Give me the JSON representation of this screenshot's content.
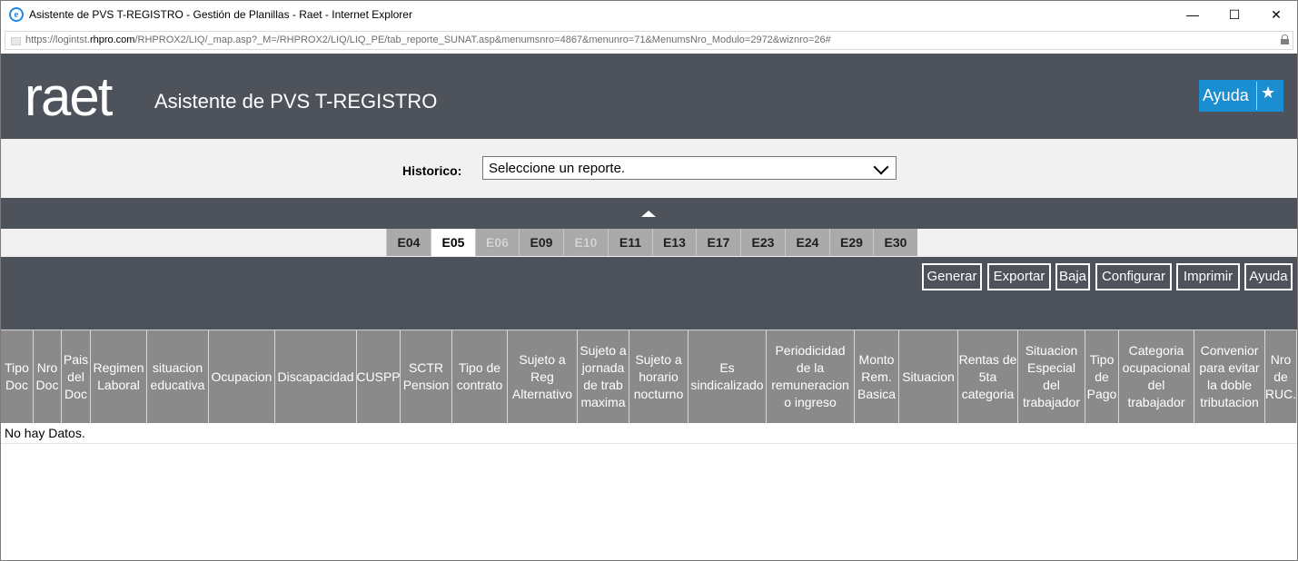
{
  "window": {
    "title": "Asistente de PVS T-REGISTRO - Gestión de Planillas - Raet - Internet Explorer",
    "controls": {
      "minimize": "—",
      "maximize": "☐",
      "close": "✕"
    },
    "icon": "ie-icon"
  },
  "address": {
    "url_prefix": "https://logintst.",
    "url_domain": "rhpro.com",
    "url_rest": "/RHPROX2/LIQ/_map.asp?_M=/RHPROX2/LIQ/LIQ_PE/tab_reporte_SUNAT.asp&menumsnro=4867&menunro=71&MenumsNro_Modulo=2972&wiznro=26#"
  },
  "header": {
    "logo": "raet",
    "title": "Asistente de PVS T-REGISTRO",
    "help_label": "Ayuda",
    "favorite_icon": "star-icon"
  },
  "historico": {
    "label": "Historico:",
    "selected": "Seleccione un reporte."
  },
  "tabs": [
    {
      "label": "E04",
      "state": "normal"
    },
    {
      "label": "E05",
      "state": "active"
    },
    {
      "label": "E06",
      "state": "disabled"
    },
    {
      "label": "E09",
      "state": "normal"
    },
    {
      "label": "E10",
      "state": "disabled"
    },
    {
      "label": "E11",
      "state": "normal"
    },
    {
      "label": "E13",
      "state": "normal"
    },
    {
      "label": "E17",
      "state": "normal"
    },
    {
      "label": "E23",
      "state": "normal"
    },
    {
      "label": "E24",
      "state": "normal"
    },
    {
      "label": "E29",
      "state": "normal"
    },
    {
      "label": "E30",
      "state": "normal"
    }
  ],
  "actions": [
    "Generar",
    "Exportar",
    "Baja",
    "Configurar",
    "Imprimir",
    "Ayuda"
  ],
  "columns": [
    "Tipo Doc",
    "Nro Doc",
    "Pais del Doc",
    "Regimen Laboral",
    "situacion educativa",
    "Ocupacion",
    "Discapacidad",
    "CUSPP",
    "SCTR Pension",
    "Tipo de contrato",
    "Sujeto a Reg Alternativo",
    "Sujeto a jornada de trab maxima",
    "Sujeto a horario nocturno",
    "Es sindicalizado",
    "Periodicidad de la remuneracion o ingreso",
    "Monto Rem. Basica",
    "Situacion",
    "Rentas de 5ta categoria",
    "Situacion Especial del trabajador",
    "Tipo de Pago",
    "Categoria ocupacional del trabajador",
    "Convenior para evitar la doble tributacion",
    "Nro de RUC."
  ],
  "empty_message": "No hay Datos."
}
